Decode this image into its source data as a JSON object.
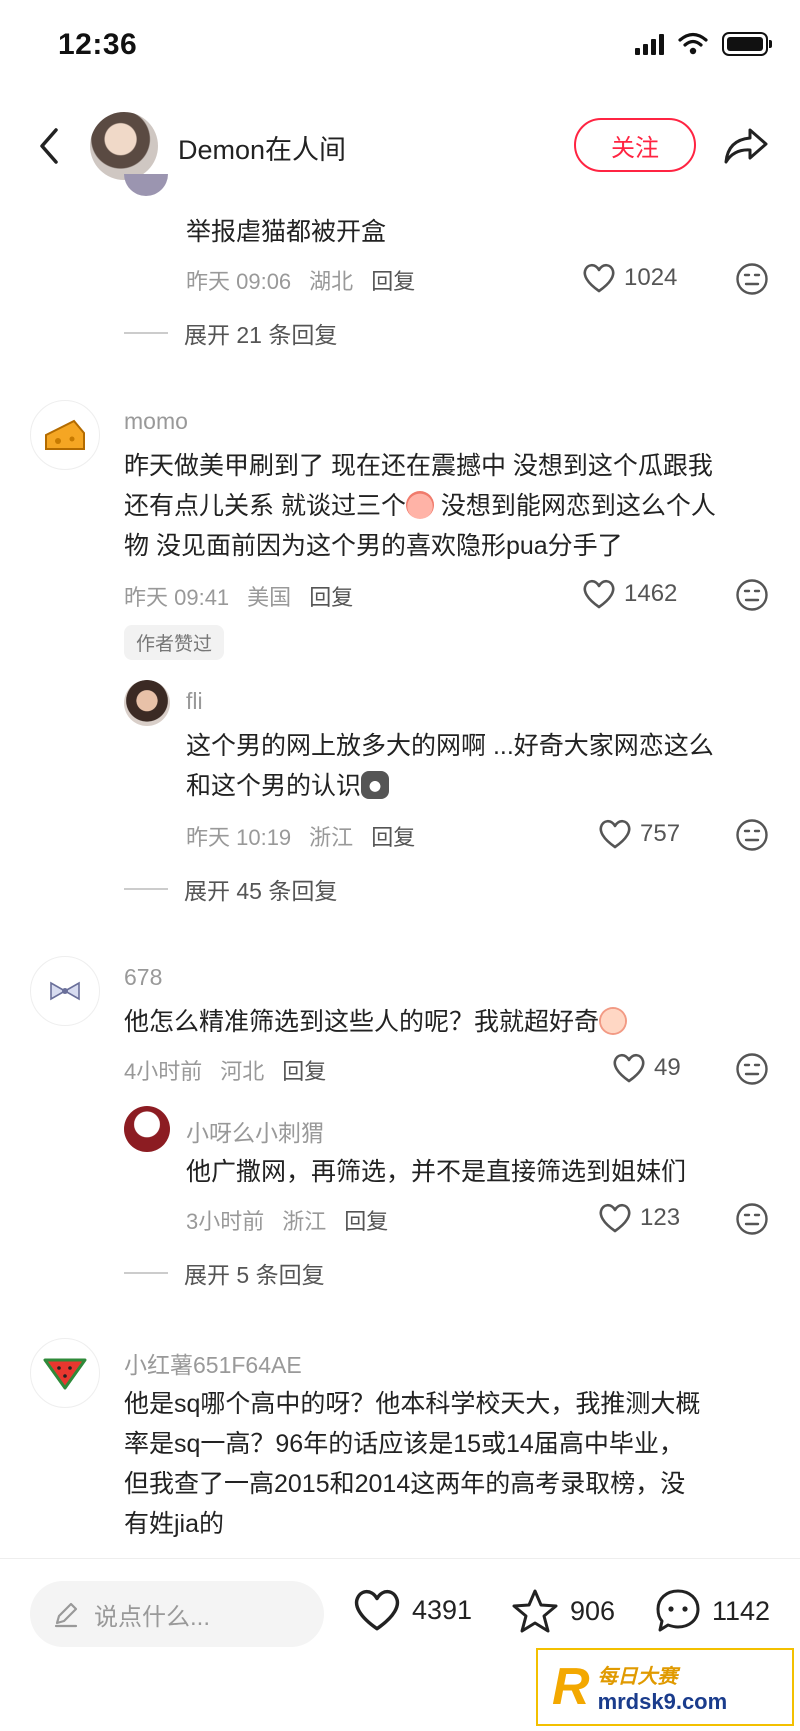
{
  "status": {
    "time": "12:36"
  },
  "header": {
    "user_name": "Demon在人间",
    "follow_label": "关注"
  },
  "comments": [
    {
      "text": "举报虐猫都被开盒",
      "time": "昨天 09:06",
      "location": "湖北",
      "reply": "回复",
      "likes": "1024",
      "expand": "展开 21 条回复"
    },
    {
      "user": "momo",
      "text_lines": [
        "昨天做美甲刷到了 现在还在震撼中 没想到这个瓜跟我",
        "还有点儿关系 就谈过三个",
        " 没想到能网恋到这么个人",
        "物 没见面前因为这个男的喜欢隐形pua分手了"
      ],
      "time": "昨天 09:41",
      "location": "美国",
      "reply": "回复",
      "likes": "1462",
      "badge": "作者赞过",
      "sub": {
        "user": "fli",
        "text_lines": [
          "这个男的网上放多大的网啊 ...好奇大家网恋这么",
          "和这个男的认识"
        ],
        "time": "昨天 10:19",
        "location": "浙江",
        "reply": "回复",
        "likes": "757"
      },
      "expand": "展开 45 条回复"
    },
    {
      "user": "678",
      "text": "他怎么精准筛选到这些人的呢？我就超好奇",
      "time": "4小时前",
      "location": "河北",
      "reply": "回复",
      "likes": "49",
      "sub": {
        "user": "小呀么小刺猬",
        "text": "他广撒网，再筛选，并不是直接筛选到姐妹们",
        "time": "3小时前",
        "location": "浙江",
        "reply": "回复",
        "likes": "123"
      },
      "expand": "展开 5 条回复"
    },
    {
      "user": "小红薯651F64AE",
      "text_lines": [
        "他是sq哪个高中的呀？他本科学校天大，我推测大概",
        "率是sq一高？96年的话应该是15或14届高中毕业，",
        "但我查了一高2015和2014这两年的高考录取榜，没",
        "有姓jia的"
      ]
    }
  ],
  "bottom_bar": {
    "input_placeholder": "说点什么...",
    "likes": "4391",
    "stars": "906",
    "comments": "1142"
  },
  "watermark": {
    "brand": "每日大赛",
    "site": "mrdsk9.com"
  },
  "colors": {
    "accent": "#ff2442",
    "muted": "#999999"
  }
}
